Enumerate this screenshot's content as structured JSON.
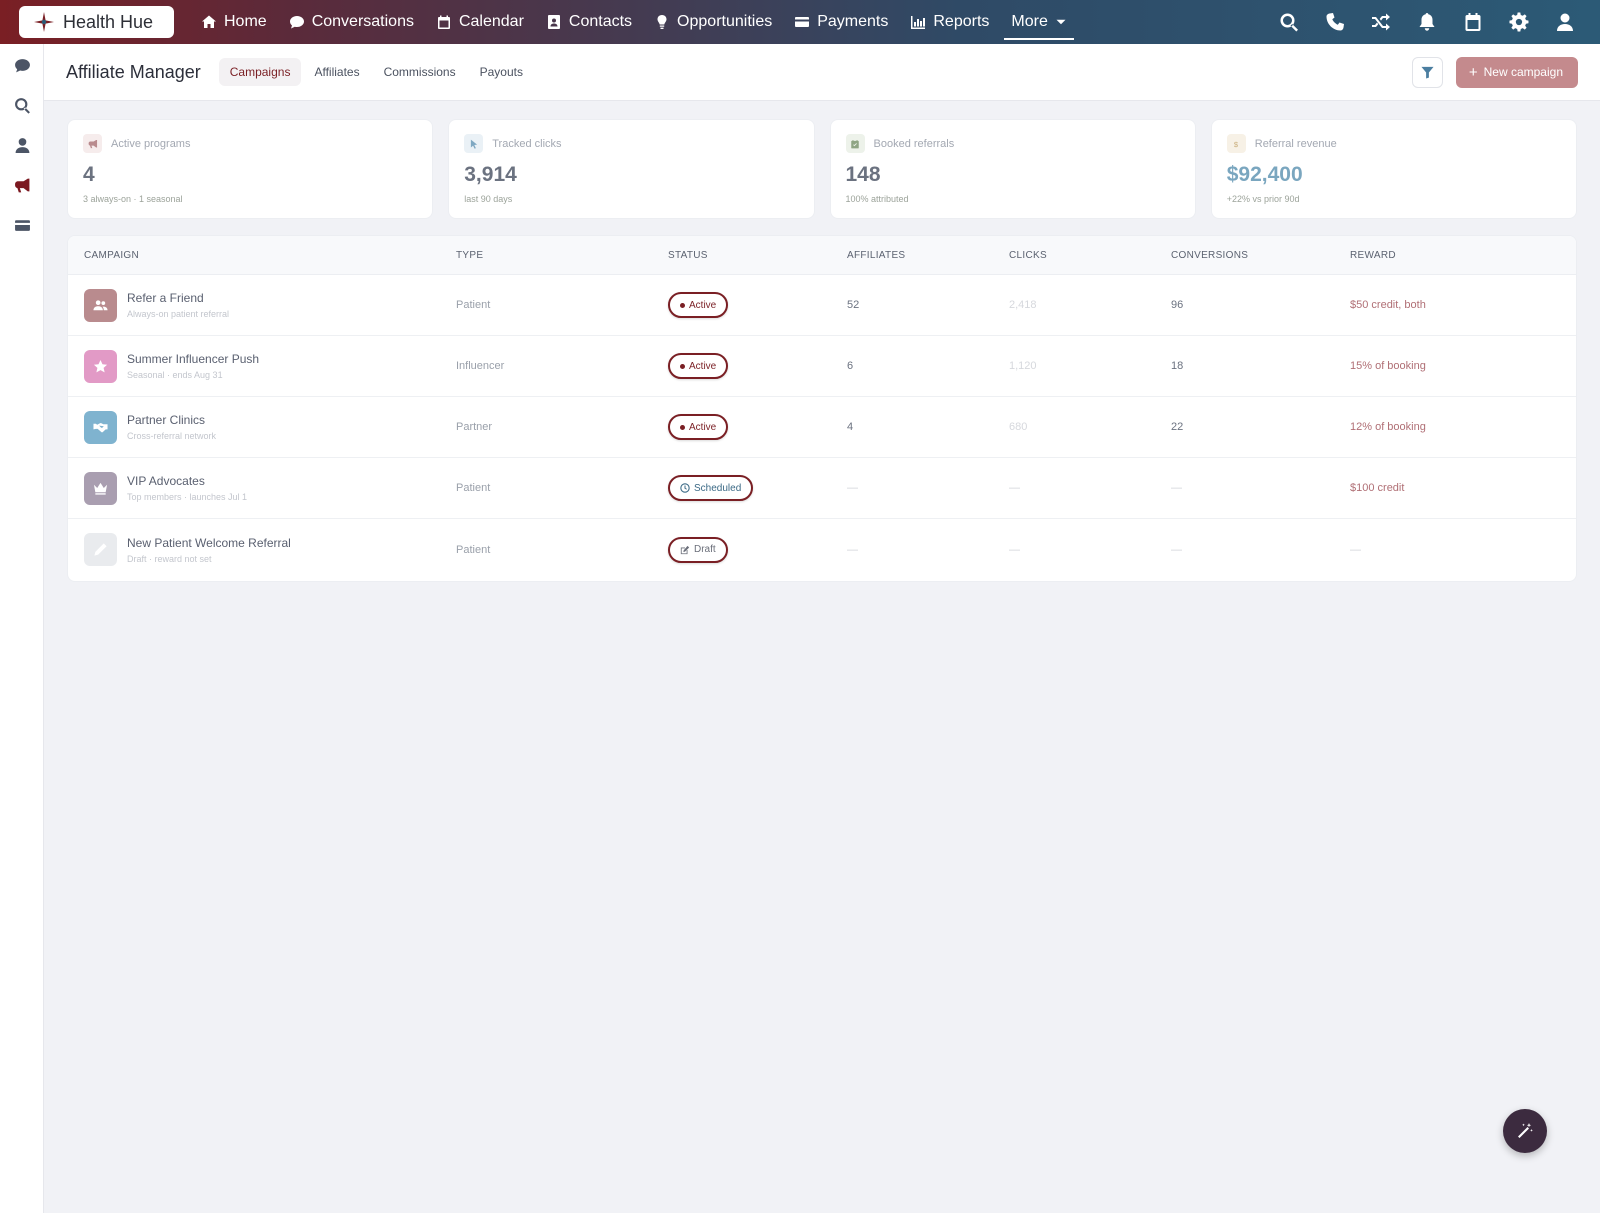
{
  "brand": {
    "name": "Health Hue"
  },
  "nav": {
    "items": [
      {
        "label": "Home",
        "icon": "home-icon"
      },
      {
        "label": "Conversations",
        "icon": "chat-icon"
      },
      {
        "label": "Calendar",
        "icon": "calendar-icon"
      },
      {
        "label": "Contacts",
        "icon": "contact-card-icon"
      },
      {
        "label": "Opportunities",
        "icon": "lightbulb-icon"
      },
      {
        "label": "Payments",
        "icon": "credit-card-icon"
      },
      {
        "label": "Reports",
        "icon": "bar-chart-icon"
      },
      {
        "label": "More",
        "icon": "caret-down-icon"
      }
    ],
    "right_icons": [
      "search-icon",
      "phone-icon",
      "shuffle-icon",
      "bell-icon",
      "calendar-icon",
      "gear-icon",
      "user-icon"
    ]
  },
  "rail": {
    "icons": [
      "chat-icon",
      "search-icon",
      "user-icon",
      "megaphone-icon",
      "credit-card-icon"
    ],
    "active": "megaphone-icon"
  },
  "page": {
    "title": "Affiliate Manager",
    "tabs": [
      "Campaigns",
      "Affiliates",
      "Commissions",
      "Payouts"
    ],
    "active_tab": "Campaigns",
    "new_button": "New campaign"
  },
  "stats": [
    {
      "label": "Active programs",
      "value": "4",
      "sub": "3 always-on · 1 seasonal",
      "icon": "megaphone-icon",
      "color": "#7a1f24"
    },
    {
      "label": "Tracked clicks",
      "value": "3,914",
      "sub": "last 90 days",
      "icon": "cursor-icon",
      "color": "#4b7ea0"
    },
    {
      "label": "Booked referrals",
      "value": "148",
      "sub": "100% attributed",
      "icon": "calendar-check-icon",
      "color": "#6a8a5a"
    },
    {
      "label": "Referral revenue",
      "value": "$92,400",
      "sub": "+22% vs prior 90d",
      "icon": "dollar-icon",
      "color": "#c4a56a"
    }
  ],
  "table": {
    "headers": [
      "CAMPAIGN",
      "TYPE",
      "STATUS",
      "AFFILIATES",
      "CLICKS",
      "CONVERSIONS",
      "REWARD"
    ],
    "rows": [
      {
        "name": "Refer a Friend",
        "sub": "Always-on patient referral",
        "type": "Patient",
        "status": "Active",
        "affiliates": "52",
        "clicks": "2,418",
        "conversions": "96",
        "reward": "$50 credit, both",
        "icon": "users-icon",
        "color": "#b98b8e"
      },
      {
        "name": "Summer Influencer Push",
        "sub": "Seasonal · ends Aug 31",
        "type": "Influencer",
        "status": "Active",
        "affiliates": "6",
        "clicks": "1,120",
        "conversions": "18",
        "reward": "15% of booking",
        "icon": "star-icon",
        "color": "#e29ac6"
      },
      {
        "name": "Partner Clinics",
        "sub": "Cross-referral network",
        "type": "Partner",
        "status": "Active",
        "affiliates": "4",
        "clicks": "680",
        "conversions": "22",
        "reward": "12% of booking",
        "icon": "handshake-icon",
        "color": "#7fb3cf"
      },
      {
        "name": "VIP Advocates",
        "sub": "Top members · launches Jul 1",
        "type": "Patient",
        "status": "Scheduled",
        "affiliates": "—",
        "clicks": "—",
        "conversions": "—",
        "reward": "$100 credit",
        "icon": "crown-icon",
        "color": "#a99eb0"
      },
      {
        "name": "New Patient Welcome Referral",
        "sub": "Draft · reward not set",
        "type": "Patient",
        "status": "Draft",
        "affiliates": "—",
        "clicks": "—",
        "conversions": "—",
        "reward": "—",
        "icon": "pencil-icon",
        "color": "#e9ebee"
      }
    ]
  },
  "fab": {
    "icon": "magic-wand-icon"
  }
}
